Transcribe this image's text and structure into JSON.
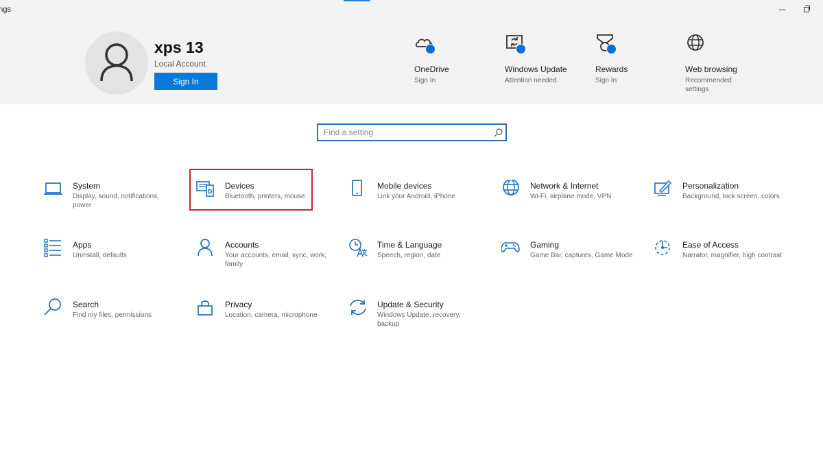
{
  "window": {
    "title": "ngs"
  },
  "account": {
    "name": "xps 13",
    "type": "Local Account",
    "sign_in_label": "Sign In"
  },
  "quick_links": [
    {
      "icon": "onedrive-cloud-icon",
      "title": "OneDrive",
      "subtitle": "Sign In"
    },
    {
      "icon": "windows-update-icon",
      "title": "Windows Update",
      "subtitle": "Attention needed"
    },
    {
      "icon": "rewards-medal-icon",
      "title": "Rewards",
      "subtitle": "Sign In"
    },
    {
      "icon": "globe-icon",
      "title": "Web browsing",
      "subtitle": "Recommended settings"
    }
  ],
  "search": {
    "placeholder": "Find a setting"
  },
  "categories": [
    {
      "icon": "laptop-icon",
      "title": "System",
      "subtitle": "Display, sound, notifications, power"
    },
    {
      "icon": "devices-icon",
      "title": "Devices",
      "subtitle": "Bluetooth, printers, mouse"
    },
    {
      "icon": "phone-icon",
      "title": "Mobile devices",
      "subtitle": "Link your Android, iPhone"
    },
    {
      "icon": "globe-icon",
      "title": "Network & Internet",
      "subtitle": "Wi-Fi, airplane mode, VPN"
    },
    {
      "icon": "paintbrush-icon",
      "title": "Personalization",
      "subtitle": "Background, lock screen, colors"
    },
    {
      "icon": "apps-list-icon",
      "title": "Apps",
      "subtitle": "Uninstall, defaults"
    },
    {
      "icon": "person-icon",
      "title": "Accounts",
      "subtitle": "Your accounts, email, sync, work, family"
    },
    {
      "icon": "time-language-icon",
      "title": "Time & Language",
      "subtitle": "Speech, region, date"
    },
    {
      "icon": "gamepad-icon",
      "title": "Gaming",
      "subtitle": "Game Bar, captures, Game Mode"
    },
    {
      "icon": "ease-of-access-icon",
      "title": "Ease of Access",
      "subtitle": "Narrator, magnifier, high contrast"
    },
    {
      "icon": "search-icon",
      "title": "Search",
      "subtitle": "Find my files, permissions"
    },
    {
      "icon": "lock-icon",
      "title": "Privacy",
      "subtitle": "Location, camera, microphone"
    },
    {
      "icon": "sync-arrows-icon",
      "title": "Update & Security",
      "subtitle": "Windows Update, recovery, backup"
    }
  ],
  "colors": {
    "accent": "#0a78d7",
    "header_bg": "#f2f2f2",
    "highlight": "#c0272d",
    "icon": "#1f6fbf"
  }
}
